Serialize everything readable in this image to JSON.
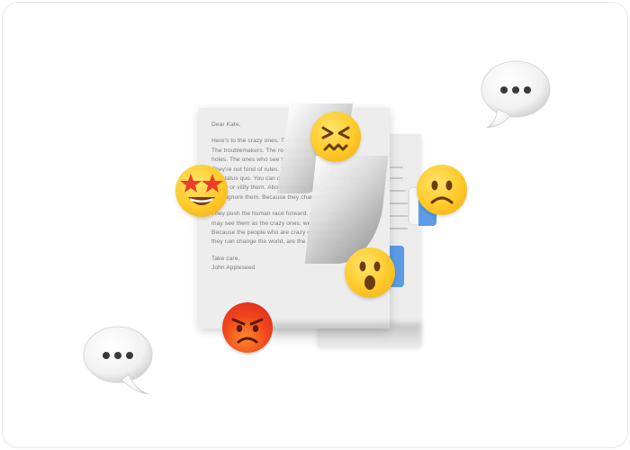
{
  "letter": {
    "greeting": "Dear Kate,",
    "paragraph1": "Here's to the crazy ones. The misfits. The rebels.\nThe troublemakers. The round pegs in the square\nholes. The ones who see things differently.\nThey're not fond of rules. And they have no respect for\nthe status quo. You can quote them, disagree with them,\nglorify or vilify them. About the only thing you can't\ndo is ignore them. Because they change things.",
    "paragraph2": "They push the human race forward. And while some\nmay see them as the crazy ones, we see genius.\nBecause the people who are crazy enough to think\nthey can change the world, are the ones who do.",
    "closing": "Take care,",
    "signature": "John Appleseed"
  },
  "colors": {
    "accent_blue": "#5b9be8",
    "emoji_yellow": "#ffc928",
    "emoji_angry": "#e8351c"
  },
  "icons": [
    "speech-bubble-icon",
    "confounded-face-icon",
    "star-struck-face-icon",
    "frowning-face-icon",
    "hushed-face-icon",
    "angry-face-icon"
  ]
}
